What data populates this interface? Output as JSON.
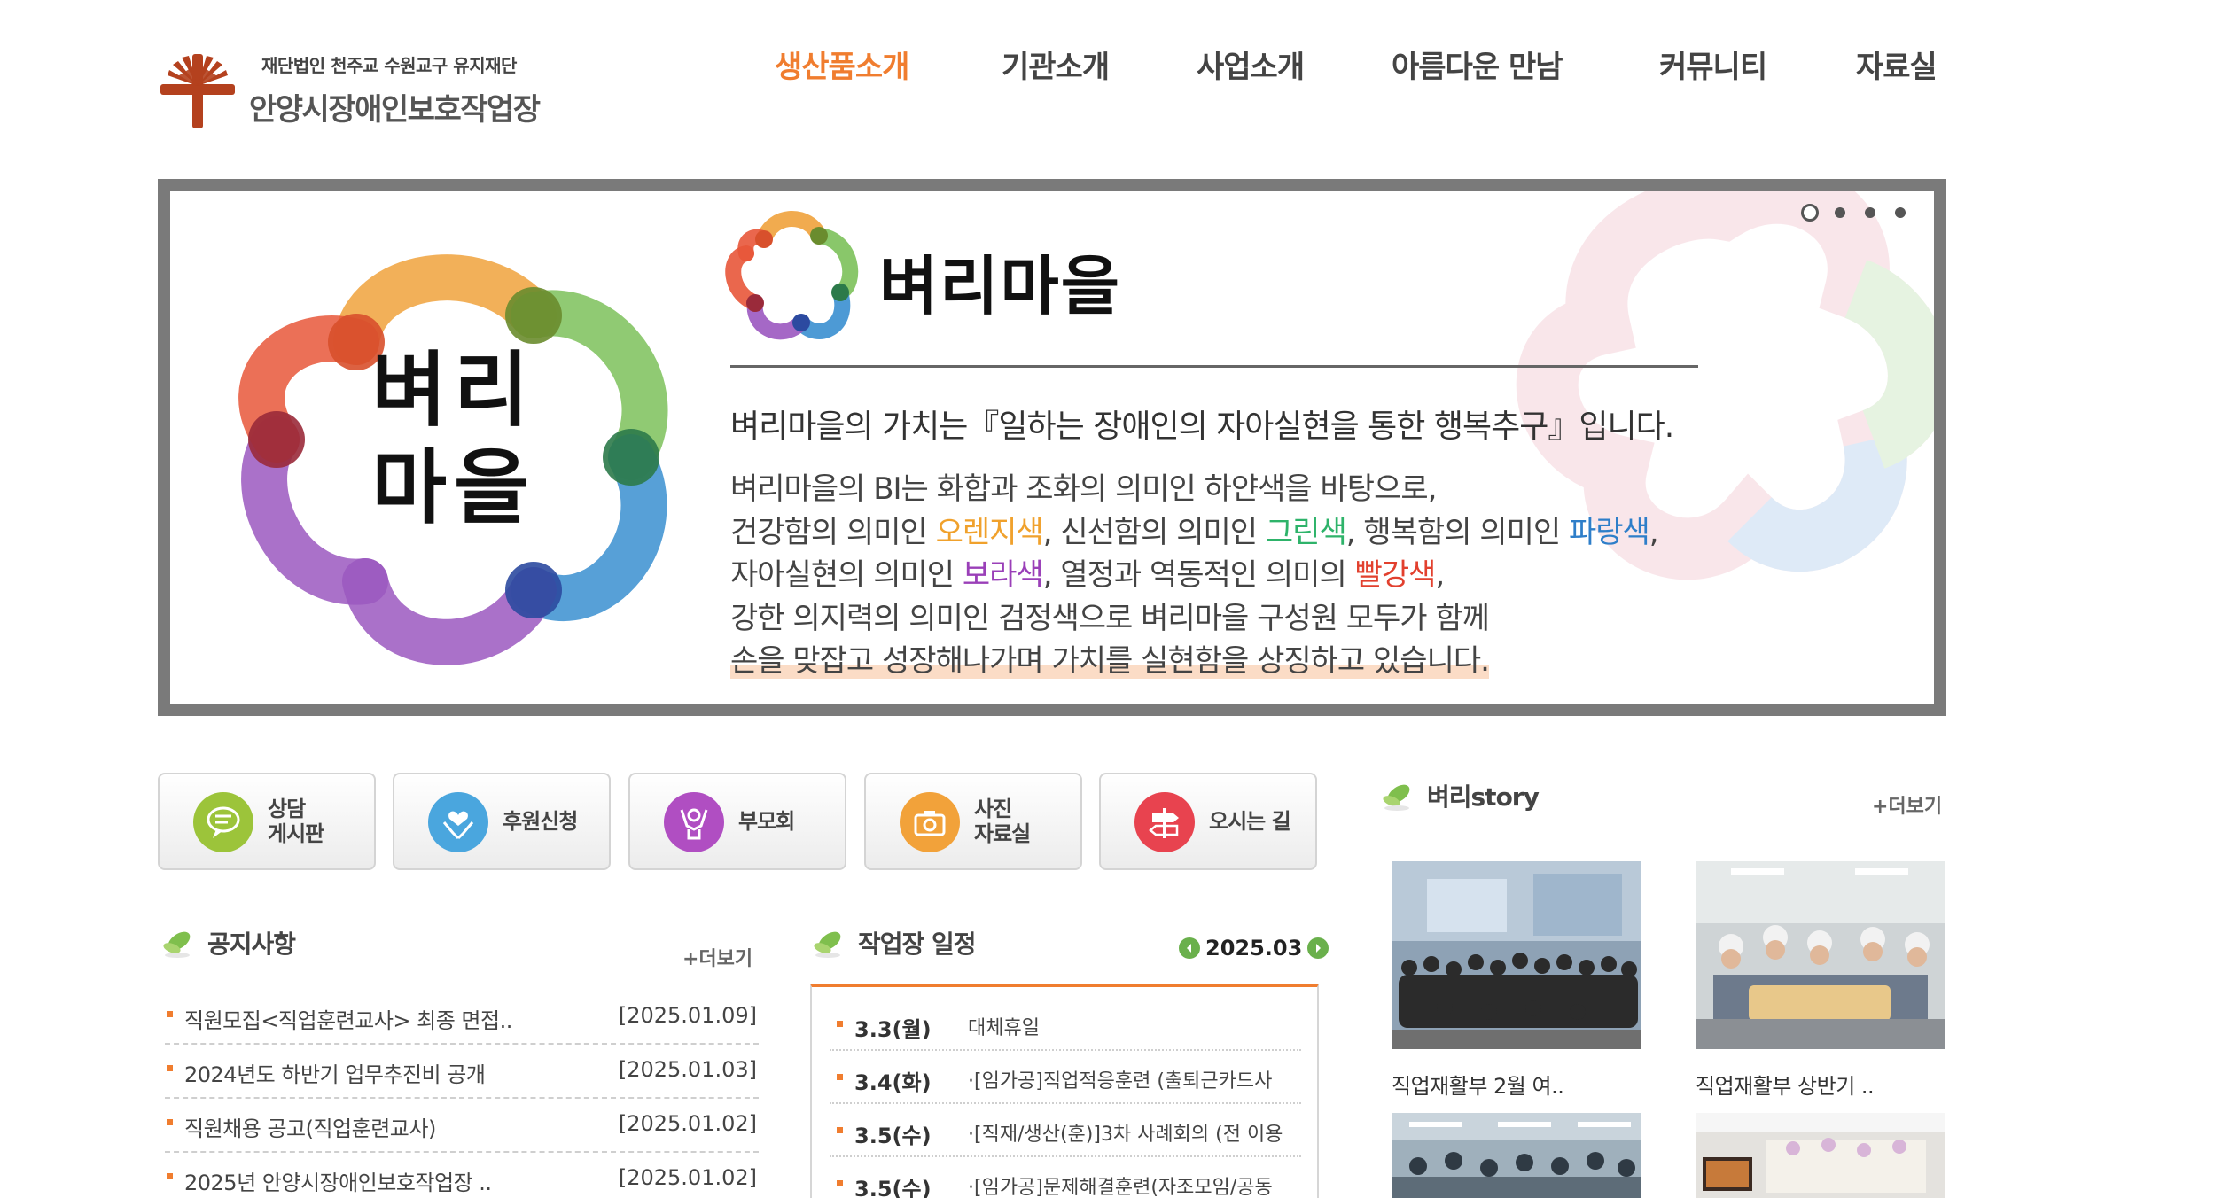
{
  "brand": {
    "foundation": "재단법인 천주교 수원교구 유지재단",
    "name": "안양시장애인보호작업장"
  },
  "nav": {
    "items": [
      {
        "label": "생산품소개",
        "active": true
      },
      {
        "label": "기관소개",
        "active": false
      },
      {
        "label": "사업소개",
        "active": false
      },
      {
        "label": "아름다운 만남",
        "active": false
      },
      {
        "label": "커뮤니티",
        "active": false
      },
      {
        "label": "자료실",
        "active": false
      }
    ]
  },
  "banner": {
    "logo_text_line1": "벼리",
    "logo_text_line2": "마을",
    "bi_title": "벼리마을",
    "lead": "벼리마을의 가치는『일하는 장애인의 자아실현을 통한 행복추구』입니다.",
    "line1": "벼리마을의 BI는 화합과 조화의 의미인 하얀색을 바탕으로,",
    "line2_a": "건강함의 의미인 ",
    "line2_orange": "오렌지색",
    "line2_b": ", 신선함의 의미인 ",
    "line2_green": "그린색",
    "line2_c": ", 행복함의 의미인 ",
    "line2_blue": "파랑색",
    "line2_d": ",",
    "line3_a": "자아실현의 의미인 ",
    "line3_purple": "보라색",
    "line3_b": ", 열정과 역동적인 의미의 ",
    "line3_red": "빨강색",
    "line3_c": ",",
    "line4": "강한 의지력의 의미인 검정색으로 벼리마을 구성원 모두가 함께",
    "line5": "손을 맞잡고 성장해나가며 가치를 실현함을 상징하고 있습니다.",
    "slide_count": 4,
    "active_slide": 1
  },
  "quick_menu": [
    {
      "label": "상담\n게시판",
      "icon": "speech-bubble-icon",
      "color": "#9cc43a"
    },
    {
      "label": "후원신청",
      "icon": "hands-heart-icon",
      "color": "#4aa6de"
    },
    {
      "label": "부모회",
      "icon": "people-hug-icon",
      "color": "#b04ec2"
    },
    {
      "label": "사진\n자료실",
      "icon": "camera-icon",
      "color": "#f2a23a"
    },
    {
      "label": "오시는 길",
      "icon": "signpost-icon",
      "color": "#e8434f"
    }
  ],
  "notice": {
    "title": "공지사항",
    "more": "+더보기",
    "items": [
      {
        "title": "직원모집<직업훈련교사> 최종 면접..",
        "date": "[2025.01.09]"
      },
      {
        "title": "2024년도 하반기 업무추진비 공개",
        "date": "[2025.01.03]"
      },
      {
        "title": "직원채용 공고(직업훈련교사)",
        "date": "[2025.01.02]"
      },
      {
        "title": "2025년 안양시장애인보호작업장 ..",
        "date": "[2025.01.02]"
      }
    ]
  },
  "schedule": {
    "title": "작업장 일정",
    "month": "2025.03",
    "items": [
      {
        "day": "3.3(월)",
        "desc": "대체휴일"
      },
      {
        "day": "3.4(화)",
        "desc": "·[임가공]직업적응훈련 (출퇴근카드사"
      },
      {
        "day": "3.5(수)",
        "desc": "·[직재/생산(훈)]3차 사례회의 (전 이용"
      },
      {
        "day": "3.5(수)",
        "desc": "·[임가공]문제해결훈련(자조모임/공동"
      }
    ]
  },
  "story": {
    "title": "벼리story",
    "more": "+더보기",
    "items": [
      {
        "caption": "직업재활부 2월 여.."
      },
      {
        "caption": "직업재활부 상반기 .."
      },
      {
        "caption": ""
      },
      {
        "caption": ""
      }
    ]
  },
  "colors": {
    "accent": "#f07d2f",
    "banner_frame": "#7a7a7a",
    "leaf_green": "#6ab04c"
  }
}
